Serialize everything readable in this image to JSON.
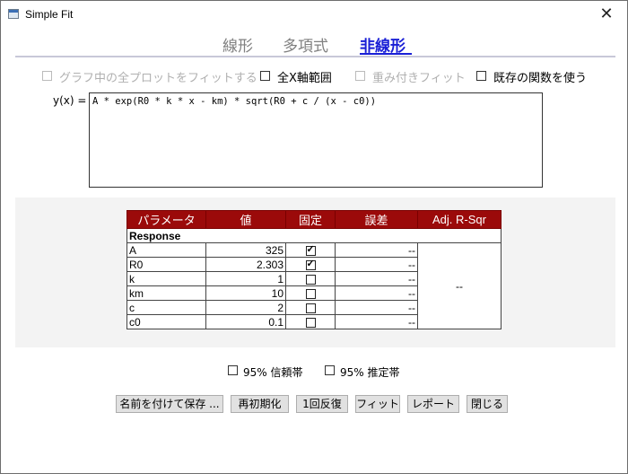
{
  "window": {
    "title": "Simple Fit",
    "close_glyph": "✕",
    "icon": "app-window-icon"
  },
  "tabs": [
    {
      "label": "線形",
      "active": false
    },
    {
      "label": "多項式",
      "active": false
    },
    {
      "label": "非線形",
      "active": true
    }
  ],
  "options": {
    "fit_all_plots": {
      "label": "グラフ中の全プロットをフィットする",
      "checked": false,
      "disabled": true
    },
    "full_x_range": {
      "label": "全X軸範囲",
      "checked": false,
      "disabled": false
    },
    "weighted_fit": {
      "label": "重み付きフィット",
      "checked": false,
      "disabled": true
    },
    "use_existing_function": {
      "label": "既存の関数を使う",
      "checked": false,
      "disabled": false
    }
  },
  "formula": {
    "label": "y(x) =",
    "value": "A * exp(R0 * k * x - km) * sqrt(R0 + c / (x - c0))"
  },
  "table": {
    "headers": {
      "param": "パラメータ",
      "value": "値",
      "fixed": "固定",
      "error": "誤差",
      "adj_r_sqr": "Adj. R-Sqr"
    },
    "section_label": "Response",
    "adj_r_sqr_value": "--",
    "rows": [
      {
        "param": "A",
        "value": "325",
        "fixed": true,
        "error": "--"
      },
      {
        "param": "R0",
        "value": "2.303",
        "fixed": true,
        "error": "--"
      },
      {
        "param": "k",
        "value": "1",
        "fixed": false,
        "error": "--"
      },
      {
        "param": "km",
        "value": "10",
        "fixed": false,
        "error": "--"
      },
      {
        "param": "c",
        "value": "2",
        "fixed": false,
        "error": "--"
      },
      {
        "param": "c0",
        "value": "0.1",
        "fixed": false,
        "error": "--"
      }
    ]
  },
  "bands": {
    "confidence": {
      "label": "95% 信頼帯",
      "checked": false
    },
    "prediction": {
      "label": "95% 推定帯",
      "checked": false
    }
  },
  "buttons": {
    "save_as": "名前を付けて保存 ...",
    "reinitialize": "再初期化",
    "one_iteration": "1回反復",
    "fit": "フィット",
    "report": "レポート",
    "close": "閉じる"
  },
  "colors": {
    "accent": "#1a20d6",
    "table_header": "#9b0a0a",
    "disabled_text": "#b0b0b0"
  }
}
